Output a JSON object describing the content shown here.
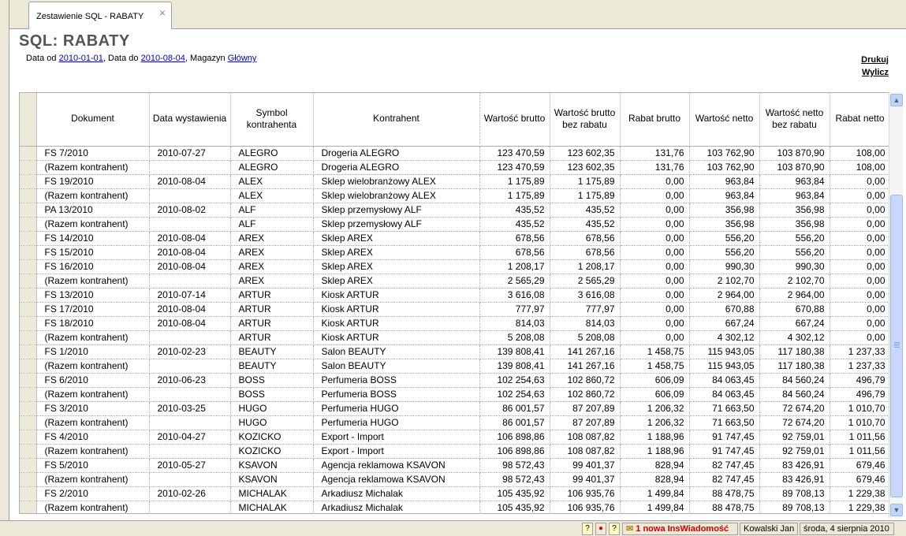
{
  "tab": {
    "label": "Zestawienie SQL - RABATY",
    "close": "×"
  },
  "report": {
    "title": "SQL: RABATY",
    "filters": {
      "date_from_label": "Data od",
      "date_from": "2010-01-01",
      "date_to_label": "Data do",
      "date_to": "2010-08-04",
      "warehouse_label": "Magazyn",
      "warehouse": "Główny"
    },
    "actions": {
      "print": "Drukuj",
      "calculate": "Wylicz"
    }
  },
  "table": {
    "columns": [
      "Dokument",
      "Data wystawienia",
      "Symbol kontrahenta",
      "Kontrahent",
      "Wartość brutto",
      "Wartość brutto bez rabatu",
      "Rabat brutto",
      "Wartość netto",
      "Wartość netto bez rabatu",
      "Rabat netto"
    ],
    "rows": [
      [
        "FS 7/2010",
        "2010-07-27",
        "ALEGRO",
        "Drogeria ALEGRO",
        "123 470,59",
        "123 602,35",
        "131,76",
        "103 762,90",
        "103 870,90",
        "108,00"
      ],
      [
        "(Razem kontrahent)",
        "",
        "ALEGRO",
        "Drogeria ALEGRO",
        "123 470,59",
        "123 602,35",
        "131,76",
        "103 762,90",
        "103 870,90",
        "108,00"
      ],
      [
        "FS 19/2010",
        "2010-08-04",
        "ALEX",
        "Sklep wielobranżowy  ALEX",
        "1 175,89",
        "1 175,89",
        "0,00",
        "963,84",
        "963,84",
        "0,00"
      ],
      [
        "(Razem kontrahent)",
        "",
        "ALEX",
        "Sklep wielobranżowy  ALEX",
        "1 175,89",
        "1 175,89",
        "0,00",
        "963,84",
        "963,84",
        "0,00"
      ],
      [
        "PA 13/2010",
        "2010-08-02",
        "ALF",
        "Sklep przemysłowy ALF",
        "435,52",
        "435,52",
        "0,00",
        "356,98",
        "356,98",
        "0,00"
      ],
      [
        "(Razem kontrahent)",
        "",
        "ALF",
        "Sklep przemysłowy ALF",
        "435,52",
        "435,52",
        "0,00",
        "356,98",
        "356,98",
        "0,00"
      ],
      [
        "FS 14/2010",
        "2010-08-04",
        "AREX",
        "Sklep AREX",
        "678,56",
        "678,56",
        "0,00",
        "556,20",
        "556,20",
        "0,00"
      ],
      [
        "FS 15/2010",
        "2010-08-04",
        "AREX",
        "Sklep AREX",
        "678,56",
        "678,56",
        "0,00",
        "556,20",
        "556,20",
        "0,00"
      ],
      [
        "FS 16/2010",
        "2010-08-04",
        "AREX",
        "Sklep AREX",
        "1 208,17",
        "1 208,17",
        "0,00",
        "990,30",
        "990,30",
        "0,00"
      ],
      [
        "(Razem kontrahent)",
        "",
        "AREX",
        "Sklep AREX",
        "2 565,29",
        "2 565,29",
        "0,00",
        "2 102,70",
        "2 102,70",
        "0,00"
      ],
      [
        "FS 13/2010",
        "2010-07-14",
        "ARTUR",
        "Kiosk ARTUR",
        "3 616,08",
        "3 616,08",
        "0,00",
        "2 964,00",
        "2 964,00",
        "0,00"
      ],
      [
        "FS 17/2010",
        "2010-08-04",
        "ARTUR",
        "Kiosk ARTUR",
        "777,97",
        "777,97",
        "0,00",
        "670,88",
        "670,88",
        "0,00"
      ],
      [
        "FS 18/2010",
        "2010-08-04",
        "ARTUR",
        "Kiosk ARTUR",
        "814,03",
        "814,03",
        "0,00",
        "667,24",
        "667,24",
        "0,00"
      ],
      [
        "(Razem kontrahent)",
        "",
        "ARTUR",
        "Kiosk ARTUR",
        "5 208,08",
        "5 208,08",
        "0,00",
        "4 302,12",
        "4 302,12",
        "0,00"
      ],
      [
        "FS 1/2010",
        "2010-02-23",
        "BEAUTY",
        "Salon BEAUTY",
        "139 808,41",
        "141 267,16",
        "1 458,75",
        "115 943,05",
        "117 180,38",
        "1 237,33"
      ],
      [
        "(Razem kontrahent)",
        "",
        "BEAUTY",
        "Salon BEAUTY",
        "139 808,41",
        "141 267,16",
        "1 458,75",
        "115 943,05",
        "117 180,38",
        "1 237,33"
      ],
      [
        "FS 6/2010",
        "2010-06-23",
        "BOSS",
        "Perfumeria BOSS",
        "102 254,63",
        "102 860,72",
        "606,09",
        "84 063,45",
        "84 560,24",
        "496,79"
      ],
      [
        "(Razem kontrahent)",
        "",
        "BOSS",
        "Perfumeria BOSS",
        "102 254,63",
        "102 860,72",
        "606,09",
        "84 063,45",
        "84 560,24",
        "496,79"
      ],
      [
        "FS 3/2010",
        "2010-03-25",
        "HUGO",
        "Perfumeria HUGO",
        "86 001,57",
        "87 207,89",
        "1 206,32",
        "71 663,50",
        "72 674,20",
        "1 010,70"
      ],
      [
        "(Razem kontrahent)",
        "",
        "HUGO",
        "Perfumeria HUGO",
        "86 001,57",
        "87 207,89",
        "1 206,32",
        "71 663,50",
        "72 674,20",
        "1 010,70"
      ],
      [
        "FS 4/2010",
        "2010-04-27",
        "KOZICKO",
        "Export - Import",
        "106 898,86",
        "108 087,82",
        "1 188,96",
        "91 747,45",
        "92 759,01",
        "1 011,56"
      ],
      [
        "(Razem kontrahent)",
        "",
        "KOZICKO",
        "Export - Import",
        "106 898,86",
        "108 087,82",
        "1 188,96",
        "91 747,45",
        "92 759,01",
        "1 011,56"
      ],
      [
        "FS 5/2010",
        "2010-05-27",
        "KSAVON",
        "Agencja reklamowa KSAVON",
        "98 572,43",
        "99 401,37",
        "828,94",
        "82 747,45",
        "83 426,91",
        "679,46"
      ],
      [
        "(Razem kontrahent)",
        "",
        "KSAVON",
        "Agencja reklamowa KSAVON",
        "98 572,43",
        "99 401,37",
        "828,94",
        "82 747,45",
        "83 426,91",
        "679,46"
      ],
      [
        "FS 2/2010",
        "2010-02-26",
        "MICHALAK",
        "Arkadiusz Michalak",
        "105 435,92",
        "106 935,76",
        "1 499,84",
        "88 478,75",
        "89 708,13",
        "1 229,38"
      ],
      [
        "(Razem kontrahent)",
        "",
        "MICHALAK",
        "Arkadiusz Michalak",
        "105 435,92",
        "106 935,76",
        "1 499,84",
        "88 478,75",
        "89 708,13",
        "1 229,38"
      ]
    ]
  },
  "scrollbar": {
    "up": "▲",
    "down": "▼"
  },
  "statusbar": {
    "help1": "?",
    "record": "●",
    "help2": "?",
    "message_icon": "✉",
    "messages": "1 nowa InsWiadomość",
    "user": "Kowalski Jan",
    "date": "środa, 4 sierpnia 2010"
  },
  "colors": {
    "link": "#0000cc",
    "notification": "#cc0000",
    "scroll_accent": "#c1d3fb"
  }
}
